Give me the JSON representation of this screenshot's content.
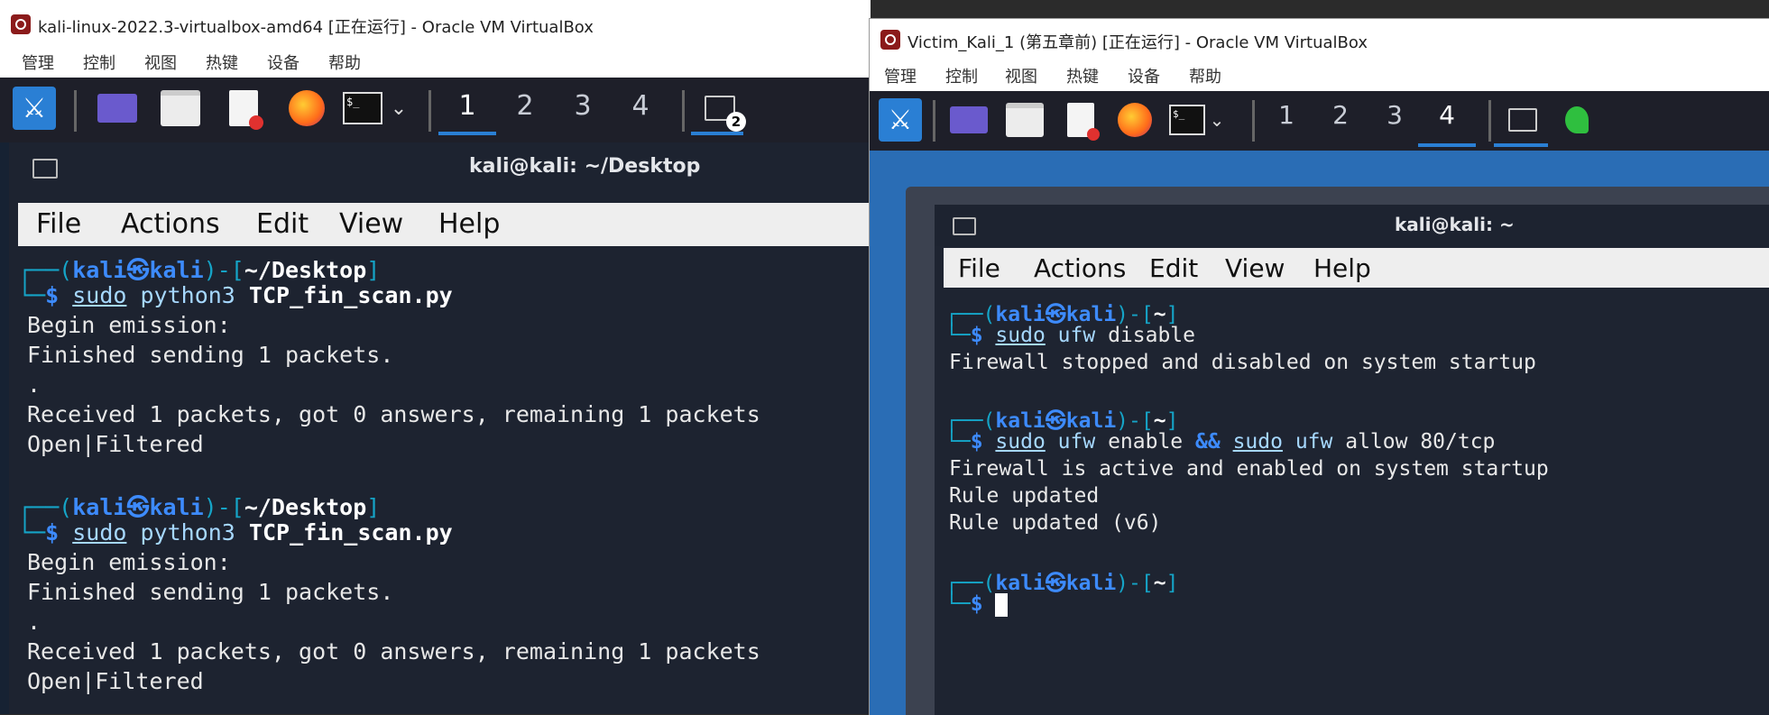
{
  "left_window": {
    "title": "kali-linux-2022.3-virtualbox-amd64 [正在运行] - Oracle VM VirtualBox",
    "menu": [
      "管理",
      "控制",
      "视图",
      "热键",
      "设备",
      "帮助"
    ],
    "workspaces": [
      "1",
      "2",
      "3",
      "4"
    ],
    "badge": "2",
    "terminal": {
      "title": "kali@kali: ~/Desktop",
      "menu": [
        "File",
        "Actions",
        "Edit",
        "View",
        "Help"
      ],
      "blocks": [
        {
          "user": "kali",
          "host": "kali",
          "path": "~/Desktop",
          "sudo": "sudo",
          "prog": "python3",
          "arg": "TCP_fin_scan.py",
          "out": [
            "Begin emission:",
            "Finished sending 1 packets.",
            ".",
            "Received 1 packets, got 0 answers, remaining 1 packets",
            "Open|Filtered"
          ]
        },
        {
          "user": "kali",
          "host": "kali",
          "path": "~/Desktop",
          "sudo": "sudo",
          "prog": "python3",
          "arg": "TCP_fin_scan.py",
          "out": [
            "Begin emission:",
            "Finished sending 1 packets.",
            ".",
            "Received 1 packets, got 0 answers, remaining 1 packets",
            "Open|Filtered"
          ]
        }
      ]
    }
  },
  "right_window": {
    "title": "Victim_Kali_1 (第五章前) [正在运行] - Oracle VM VirtualBox",
    "menu": [
      "管理",
      "控制",
      "视图",
      "热键",
      "设备",
      "帮助"
    ],
    "workspaces": [
      "1",
      "2",
      "3",
      "4"
    ],
    "terminal": {
      "title": "kali@kali: ~",
      "menu": [
        "File",
        "Actions",
        "Edit",
        "View",
        "Help"
      ],
      "blocks": [
        {
          "user": "kali",
          "host": "kali",
          "path": "~",
          "cmd": [
            "sudo",
            "ufw",
            "disable"
          ],
          "out": [
            "Firewall stopped and disabled on system startup"
          ]
        },
        {
          "user": "kali",
          "host": "kali",
          "path": "~",
          "cmd": [
            "sudo",
            "ufw",
            "enable",
            "&&",
            "sudo",
            "ufw",
            "allow 80/tcp"
          ],
          "out": [
            "Firewall is active and enabled on system startup",
            "Rule updated",
            "Rule updated (v6)"
          ]
        },
        {
          "user": "kali",
          "host": "kali",
          "path": "~"
        }
      ]
    }
  }
}
